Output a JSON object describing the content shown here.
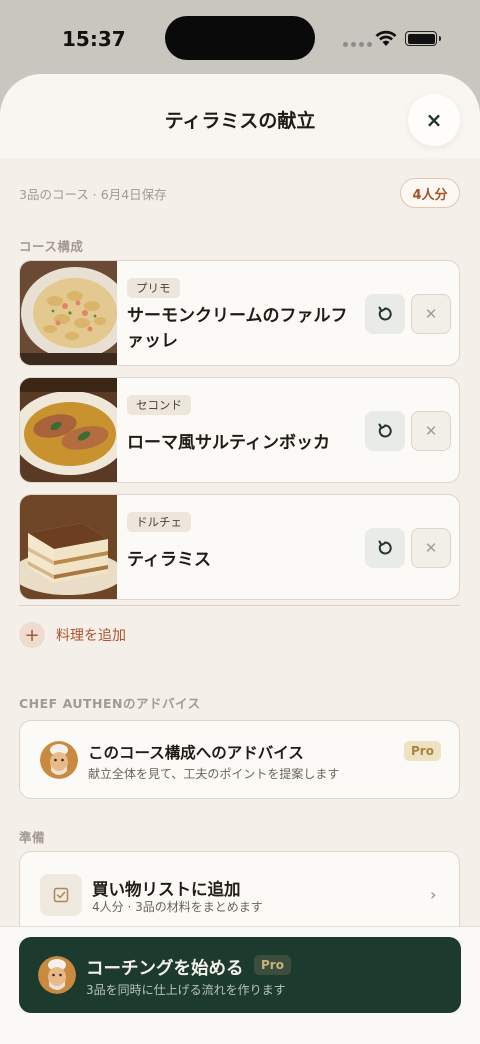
{
  "status": {
    "time": "15:37"
  },
  "sheet": {
    "title": "ティラミスの献立",
    "close_icon": "×"
  },
  "meta": {
    "summary": "3品のコース · 6月4日保存",
    "servings": "4人分"
  },
  "sections": {
    "course": "コース構成",
    "advice": "CHEF AUTHENのアドバイス",
    "prep": "準備"
  },
  "courses": [
    {
      "tag": "プリモ",
      "name": "サーモンクリームのファルファッレ",
      "image": "farfalle-pasta"
    },
    {
      "tag": "セコンド",
      "name": "ローマ風サルティンボッカ",
      "image": "saltimbocca"
    },
    {
      "tag": "ドルチェ",
      "name": "ティラミス",
      "image": "tiramisu"
    }
  ],
  "add_dish": {
    "icon": "+",
    "label": "料理を追加"
  },
  "advice": {
    "title": "このコース構成へのアドバイス",
    "subtitle": "献立全体を見て、工夫のポイントを提案します",
    "badge": "Pro"
  },
  "shopping": {
    "title": "買い物リストに追加",
    "subtitle": "4人分 · 3品の材料をまとめます",
    "chevron": "›"
  },
  "cta": {
    "title": "コーチングを始める",
    "badge": "Pro",
    "subtitle": "3品を同時に仕上げる流れを作ります"
  },
  "colors": {
    "accent": "#b0532a",
    "cta_bg": "#1c3a2e",
    "sheet_bg": "#f4efe8"
  }
}
